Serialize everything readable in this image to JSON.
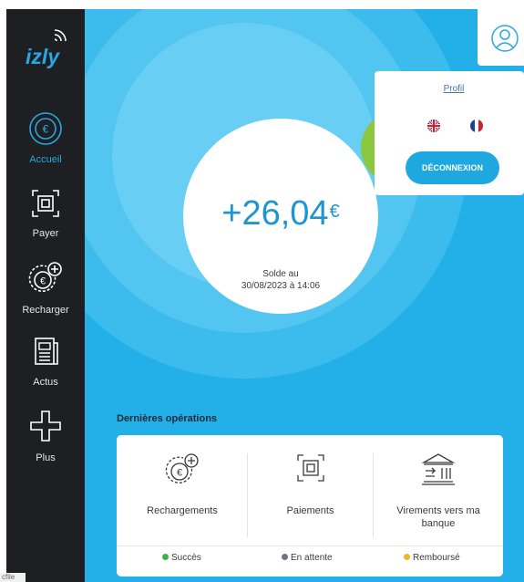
{
  "app": {
    "logo_text": "izly"
  },
  "sidebar": {
    "items": [
      {
        "label": "Accueil",
        "icon": "euro-icon"
      },
      {
        "label": "Payer",
        "icon": "scan-icon"
      },
      {
        "label": "Recharger",
        "icon": "euro-plus-icon"
      },
      {
        "label": "Actus",
        "icon": "newspaper-icon"
      },
      {
        "label": "Plus",
        "icon": "plus-icon"
      }
    ]
  },
  "balance": {
    "amount": "+26,04",
    "currency": "€",
    "caption_line1": "Solde au",
    "caption_line2": "30/08/2023 à 14:06"
  },
  "profile_menu": {
    "profil_link": "Profil",
    "languages": [
      "en",
      "fr"
    ],
    "logout_label": "DÉCONNEXION"
  },
  "operations": {
    "title": "Dernières opérations",
    "items": [
      {
        "label": "Rechargements",
        "icon": "euro-plus-icon"
      },
      {
        "label": "Paiements",
        "icon": "scan-icon"
      },
      {
        "label": "Virements vers ma banque",
        "icon": "bank-transfer-icon"
      }
    ],
    "legend": [
      {
        "label": "Succès",
        "color": "#3db24b"
      },
      {
        "label": "En attente",
        "color": "#6b7580"
      },
      {
        "label": "Remboursé",
        "color": "#f4b51e"
      }
    ]
  },
  "corner_label": "cfile",
  "colors": {
    "sidebar_bg": "#1e1f22",
    "main_bg": "#23b0e8",
    "accent": "#2aa6e0",
    "amount_color": "#1e95d0",
    "button_bg": "#1fa7df"
  }
}
